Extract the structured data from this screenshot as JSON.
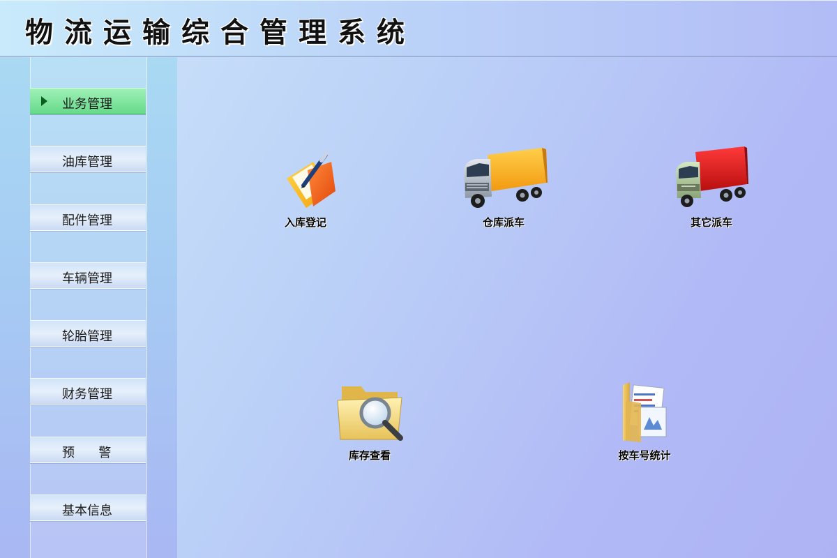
{
  "header": {
    "title": "物流运输综合管理系统"
  },
  "sidebar": {
    "items": [
      {
        "label": "业务管理",
        "active": true
      },
      {
        "label": "油库管理"
      },
      {
        "label": "配件管理"
      },
      {
        "label": "车辆管理"
      },
      {
        "label": "轮胎管理"
      },
      {
        "label": "财务管理"
      },
      {
        "label": "预      警"
      },
      {
        "label": "基本信息"
      }
    ]
  },
  "main": {
    "tiles": [
      {
        "label": "入库登记",
        "icon": "pen-folder-icon"
      },
      {
        "label": "仓库派车",
        "icon": "orange-truck-icon"
      },
      {
        "label": "其它派车",
        "icon": "red-truck-icon"
      },
      {
        "label": "库存查看",
        "icon": "folder-magnifier-icon"
      },
      {
        "label": "按车号统计",
        "icon": "documents-folder-icon"
      }
    ]
  },
  "colors": {
    "active_menu": "#7fe49e",
    "menu": "#dfeafa",
    "background": "#b1baf6"
  }
}
